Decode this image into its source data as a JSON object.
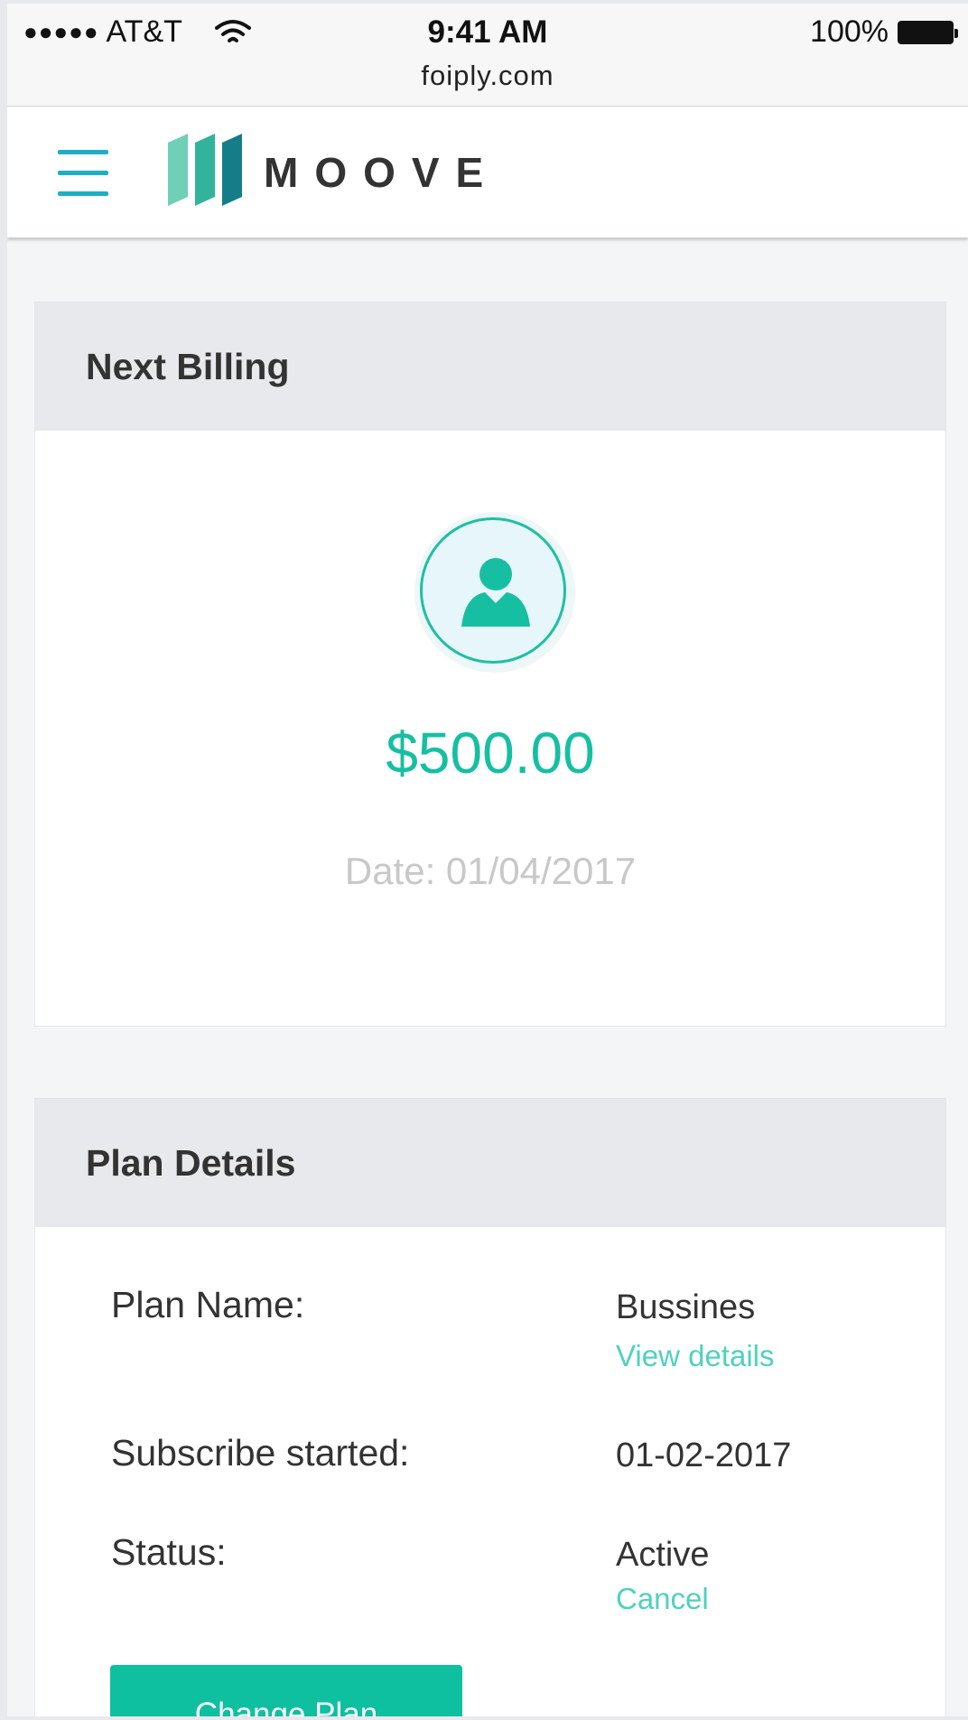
{
  "status_bar": {
    "signal": "●●●●●",
    "carrier": "AT&T",
    "time": "9:41 AM",
    "url": "foiply.com",
    "battery": "100%"
  },
  "header": {
    "menu_icon": "hamburger-icon",
    "logo_text": "MOOVE",
    "accent_color": "#1eaec4"
  },
  "billing": {
    "title": "Next Billing",
    "icon": "user-icon",
    "amount": "$500.00",
    "date": "Date: 01/04/2017",
    "accent_color": "#17bfa2"
  },
  "plan": {
    "title": "Plan Details",
    "plan_name_label": "Plan Name:",
    "plan_name_value": "Bussines",
    "view_details_link": "View details",
    "subscribe_label": "Subscribe started:",
    "subscribe_value": "01-02-2017",
    "status_label": "Status:",
    "status_value": "Active",
    "cancel_link": "Cancel",
    "change_plan_button": "Change Plan",
    "button_color": "#0fc0a0"
  }
}
